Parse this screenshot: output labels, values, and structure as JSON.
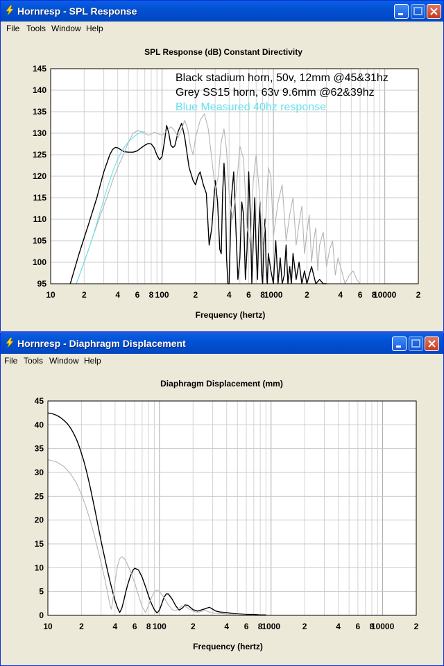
{
  "window1": {
    "title": "Hornresp - SPL Response",
    "menu": [
      "File",
      "Tools",
      "Window",
      "Help"
    ]
  },
  "window2": {
    "title": "Hornresp - Diaphragm Displacement",
    "menu": [
      "File",
      "Tools",
      "Window",
      "Help"
    ]
  },
  "icons": {
    "app": "lightning-icon",
    "minimize": "minimize-icon",
    "maximize": "maximize-icon",
    "close": "close-icon"
  },
  "colors": {
    "titlebar": "#0251D3",
    "black_series": "#000000",
    "grey_series": "#B4B4B4",
    "blue_series": "#66E0EE"
  },
  "chart_data": [
    {
      "type": "line",
      "title": "SPL Response (dB)   Constant Directivity",
      "xlabel": "Frequency (hertz)",
      "ylabel": "",
      "xscale": "log",
      "xlim": [
        10,
        20000
      ],
      "ylim": [
        95,
        145
      ],
      "yticks": [
        "145",
        "140",
        "135",
        "130",
        "125",
        "120",
        "115",
        "110",
        "105",
        "100",
        "95"
      ],
      "xticks": [
        "10",
        "2",
        "4",
        "6",
        "8",
        "100",
        "2",
        "4",
        "6",
        "8",
        "1000",
        "2",
        "4",
        "6",
        "8",
        "10000",
        "2"
      ],
      "annotations": [
        {
          "text": "Black stadium horn, 50v, 12mm @45&31hz",
          "color": "#000000"
        },
        {
          "text": "Grey SS15 horn,       63v 9.6mm @62&39hz",
          "color": "#000000"
        },
        {
          "text": "Blue Measured 40hz response",
          "color": "#66E0EE"
        }
      ],
      "series": [
        {
          "color": "#000000",
          "x": [
            15,
            18,
            22,
            26,
            30,
            34,
            36,
            38,
            40,
            43,
            46,
            50,
            55,
            60,
            65,
            70,
            75,
            80,
            85,
            90,
            95,
            100,
            105,
            110,
            115,
            120,
            125,
            130,
            140,
            150,
            160,
            175,
            190,
            200,
            210,
            220,
            235,
            250,
            265,
            280,
            300,
            315,
            330,
            340,
            350,
            360,
            370,
            380,
            390,
            400,
            420,
            440,
            460,
            480,
            500,
            520,
            540,
            560,
            580,
            600,
            620,
            640,
            660,
            680,
            700,
            720,
            740,
            760,
            780,
            800,
            820,
            840,
            860,
            880,
            900,
            950,
            1000,
            1050,
            1100,
            1150,
            1200,
            1250,
            1300,
            1350,
            1400,
            1450,
            1500,
            1600,
            1700,
            1800,
            1900,
            2000,
            2200,
            2400,
            2600,
            2800,
            3000
          ],
          "y": [
            95,
            102,
            109,
            115,
            121,
            125,
            126.2,
            126.7,
            126.6,
            126.1,
            125.7,
            125.6,
            125.6,
            125.9,
            126.6,
            127.2,
            127.6,
            127.5,
            126.6,
            124.9,
            123.8,
            124.6,
            128,
            131.8,
            130,
            127.2,
            126.7,
            127,
            130.5,
            132.3,
            129,
            122,
            119,
            118,
            120,
            121,
            118,
            116,
            104,
            108,
            119,
            114,
            103,
            102,
            116,
            123,
            117,
            101,
            95,
            95,
            115,
            121,
            108,
            96,
            101,
            114,
            111,
            96,
            103,
            121,
            111,
            95,
            105,
            115,
            103,
            96,
            108,
            114,
            98,
            95,
            104,
            110,
            99,
            95,
            102,
            98,
            95,
            105,
            95,
            101,
            95,
            97,
            104,
            95,
            99,
            95,
            102,
            96,
            100,
            95,
            98,
            95,
            99,
            95,
            96,
            95,
            95
          ]
        },
        {
          "color": "#B4B4B4",
          "x": [
            17,
            20,
            24,
            28,
            32,
            36,
            40,
            45,
            50,
            55,
            60,
            65,
            70,
            75,
            80,
            85,
            90,
            100,
            110,
            120,
            130,
            140,
            150,
            160,
            170,
            180,
            190,
            200,
            220,
            240,
            260,
            280,
            300,
            320,
            340,
            360,
            380,
            400,
            430,
            460,
            500,
            540,
            580,
            620,
            660,
            700,
            750,
            800,
            850,
            900,
            950,
            1000,
            1100,
            1200,
            1300,
            1400,
            1500,
            1600,
            1700,
            1800,
            1900,
            2000,
            2100,
            2200,
            2300,
            2400,
            2500,
            2600,
            2800,
            3000,
            3200,
            3400,
            3600,
            3800,
            4000,
            4400,
            4800,
            5200,
            5600,
            6000
          ],
          "y": [
            95,
            100,
            106,
            111,
            115,
            119,
            122,
            125,
            128,
            130,
            130.6,
            130.4,
            130,
            129.5,
            129.8,
            130.2,
            130,
            129.5,
            130.5,
            131.5,
            130.5,
            129,
            131,
            133,
            131,
            127,
            125,
            129,
            133,
            134.5,
            131,
            124,
            117,
            120,
            128,
            131,
            126,
            116,
            110,
            116,
            127,
            124,
            108,
            104,
            119,
            125,
            116,
            104,
            109,
            122,
            120,
            106,
            114,
            118,
            105,
            111,
            115,
            104,
            109,
            113,
            102,
            107,
            111,
            100,
            105,
            108,
            98,
            104,
            107,
            99,
            103,
            105,
            97,
            101,
            99,
            95,
            97,
            98,
            96,
            95
          ]
        },
        {
          "color": "#66E0EE",
          "x": [
            17,
            20,
            24,
            28,
            32,
            36,
            40,
            45,
            50,
            55,
            60,
            65,
            70
          ],
          "y": [
            95,
            100,
            106,
            112,
            117,
            121,
            124,
            126.5,
            128,
            129,
            129.8,
            130.2,
            130.4
          ]
        }
      ]
    },
    {
      "type": "line",
      "title": "Diaphragm Displacement (mm)",
      "xlabel": "Frequency (hertz)",
      "ylabel": "",
      "xscale": "log",
      "xlim": [
        10,
        20000
      ],
      "ylim": [
        0,
        45
      ],
      "yticks": [
        "45",
        "40",
        "35",
        "30",
        "25",
        "20",
        "15",
        "10",
        "5",
        "0"
      ],
      "xticks": [
        "10",
        "2",
        "4",
        "6",
        "8",
        "100",
        "2",
        "4",
        "6",
        "8",
        "1000",
        "2",
        "4",
        "6",
        "8",
        "10000",
        "2"
      ],
      "series": [
        {
          "color": "#000000",
          "x": [
            10,
            11,
            12,
            13,
            14,
            15,
            16,
            17,
            18,
            19,
            20,
            21,
            22,
            23,
            24,
            25,
            26,
            27,
            28,
            29,
            30,
            32,
            34,
            36,
            38,
            40,
            42,
            44,
            46,
            48,
            50,
            52,
            55,
            58,
            60,
            65,
            70,
            75,
            80,
            85,
            90,
            95,
            100,
            105,
            110,
            115,
            120,
            130,
            140,
            150,
            160,
            170,
            180,
            200,
            220,
            250,
            280,
            300,
            320,
            350,
            400,
            450,
            500,
            600,
            700,
            800,
            900
          ],
          "y": [
            42.5,
            42.3,
            42,
            41.5,
            40.9,
            40.2,
            39.3,
            38.2,
            37,
            35.6,
            34,
            32.4,
            30.6,
            28.7,
            26.8,
            24.8,
            22.9,
            21,
            19.1,
            17.3,
            15.6,
            12.5,
            9.7,
            7.2,
            5,
            3.1,
            1.6,
            0.6,
            1.5,
            3.2,
            5,
            6.5,
            8.3,
            9.5,
            9.9,
            9.5,
            8,
            6,
            4,
            2.4,
            1.2,
            0.5,
            1.1,
            2.5,
            3.8,
            4.5,
            4.5,
            3.4,
            2,
            1.1,
            1.5,
            2.2,
            2.1,
            1.2,
            0.9,
            1.3,
            1.7,
            1.3,
            0.9,
            0.7,
            0.6,
            0.4,
            0.3,
            0.2,
            0.2,
            0.1,
            0.1
          ]
        },
        {
          "color": "#B4B4B4",
          "x": [
            10,
            12,
            14,
            16,
            18,
            20,
            22,
            24,
            26,
            28,
            30,
            32,
            34,
            36,
            37,
            38,
            40,
            42,
            44,
            46,
            48,
            50,
            55,
            60,
            65,
            70,
            75,
            80,
            85,
            90,
            95,
            100,
            110,
            120,
            130,
            140,
            150,
            160,
            170,
            180,
            200,
            220,
            240,
            260,
            280,
            300,
            350,
            400,
            500,
            600
          ],
          "y": [
            32.7,
            32.2,
            31.2,
            29.7,
            27.8,
            25.4,
            22.7,
            19.8,
            16.9,
            13.9,
            11,
            8.1,
            5.2,
            2.2,
            1.3,
            2.8,
            7,
            10.3,
            11.9,
            12.3,
            12,
            11.4,
            9.3,
            6.8,
            4.1,
            1.8,
            0.6,
            2.2,
            3.8,
            4.9,
            5.3,
            5,
            3.7,
            2.2,
            1.2,
            1,
            1.5,
            2,
            1.9,
            1.5,
            0.9,
            0.6,
            0.9,
            1,
            0.7,
            0.5,
            0.4,
            0.3,
            0.2,
            0.1
          ]
        }
      ]
    }
  ]
}
